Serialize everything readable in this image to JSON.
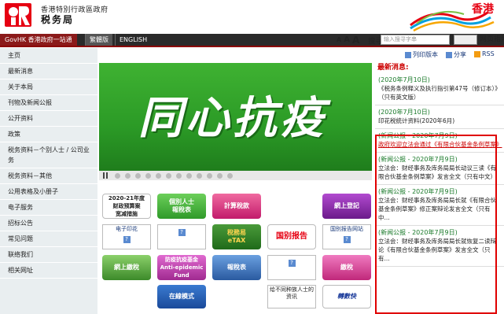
{
  "header": {
    "dept_en": "香港特別行政區政府",
    "dept_cn": "税务局",
    "brand": "香港",
    "brand_color": "#e60012"
  },
  "navbar": {
    "govhk": "GovHK 香港政府一站通",
    "lang_tc": "繁體版",
    "lang_en": "ENGLISH"
  },
  "tools": {
    "font_small": "A",
    "font_medium": "A",
    "font_large": "A",
    "search_label": "搜寻",
    "search_placeholder": "输入搜寻字串",
    "text_version": "网页指南"
  },
  "util": {
    "print": "列印版本",
    "share": "分享",
    "rss": "RSS"
  },
  "menu": [
    "主页",
    "最新消息",
    "关于本局",
    "刊物及新闻公报",
    "公开资料",
    "政策",
    "税务资料－个别人士 / 公司业务",
    "税务资料－其他",
    "公用表格及小册子",
    "电子服务",
    "招标公告",
    "常见问题",
    "联络我们",
    "相关网址"
  ],
  "banner": {
    "text": "同心抗疫"
  },
  "tiles": {
    "budget": "2020-21年度\n财政预算案\n宽减措施",
    "individual_return": "個別人士\n報稅表",
    "calculator": "計算稅款",
    "online_register": "網上登記",
    "e_stamp": "电子印花",
    "etax": "稅務易\neTAX",
    "cbc": "国别报告",
    "cbc_portal": "国别报告网站",
    "online_payment": "網上繳稅",
    "antiepidemic": "防疫抗疫基金\nAnti-epidemic Fund",
    "paper_return": "報稅表",
    "gift": "繳稅",
    "ep_online": "在線模式",
    "non_resident": "给不同种族人士的资讯",
    "fast": "轉數快"
  },
  "news": {
    "header": "最新消息:",
    "items": [
      {
        "date": "(2020年7月10日)",
        "body": "《税务条例释义及执行指引第47号（修订本）》（只有英文版）",
        "style": "normal"
      },
      {
        "date": "(2020年7月10日)",
        "body": "印花税统计资料(2020年6月)",
        "style": "normal"
      },
      {
        "date": "(新闻公报 - 2020年7月9日)",
        "body": "政府欢迎立法会通过《有限合伙基金条例草案》",
        "style": "red"
      },
      {
        "date": "(新闻公报 - 2020年7月9日)",
        "body": "立法会：财经事务及库务局局长动议三读《有限合伙基金条例草案》发言全文（只有中文）",
        "style": "normal"
      },
      {
        "date": "(新闻公报 - 2020年7月9日)",
        "body": "立法会：财经事务及库务局局长就《有限合伙基金条例草案》修正案辩论发言全文（只有中...",
        "style": "normal"
      },
      {
        "date": "(新闻公报 - 2020年7月9日)",
        "body": "立法会：财经事务及库务局局长就恢复二读辩论《有限合伙基金条例草案》发言全文（只有...",
        "style": "normal"
      }
    ]
  }
}
